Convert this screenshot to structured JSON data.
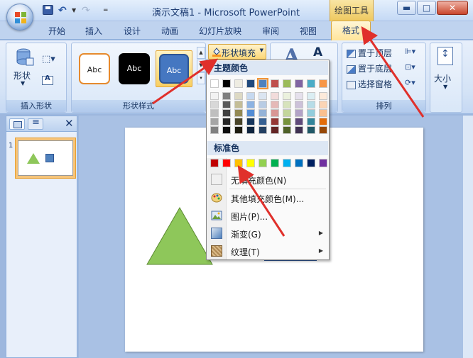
{
  "window": {
    "title": "演示文稿1 - Microsoft PowerPoint",
    "contextual_label": "绘图工具"
  },
  "title_buttons": {
    "min": "▬",
    "max": "□",
    "close": "✕"
  },
  "quick_access": {
    "undo": "↶",
    "redo": "↷",
    "dropdown": "▼",
    "customize": "═"
  },
  "tabs": [
    "开始",
    "插入",
    "设计",
    "动画",
    "幻灯片放映",
    "审阅",
    "视图",
    "格式"
  ],
  "ribbon": {
    "insert_shapes": {
      "shape_button": "形状",
      "group_label": "插入形状"
    },
    "shape_styles": {
      "styles": [
        "Abc",
        "Abc",
        "Abc"
      ],
      "group_label": "形状样式",
      "fill_button": "形状填充"
    },
    "arrange": {
      "bring_front": "置于顶层",
      "send_back": "置于底层",
      "selection_pane": "选择窗格",
      "group_label": "排列"
    },
    "size": {
      "label": "大小"
    }
  },
  "fill_menu": {
    "theme_colors_label": "主题颜色",
    "standard_colors_label": "标准色",
    "theme_top": [
      "#ffffff",
      "#000000",
      "#eeece1",
      "#1f497d",
      "#4f81bd",
      "#c0504d",
      "#9bbb59",
      "#8064a2",
      "#4bacc6",
      "#f79646"
    ],
    "theme_shades": [
      [
        "#f2f2f2",
        "#d8d8d8",
        "#bfbfbf",
        "#a5a5a5",
        "#7f7f7f"
      ],
      [
        "#7f7f7f",
        "#595959",
        "#3f3f3f",
        "#262626",
        "#0c0c0c"
      ],
      [
        "#ddd9c3",
        "#c4bd97",
        "#938953",
        "#494429",
        "#1d1b10"
      ],
      [
        "#c6d9f0",
        "#8db3e2",
        "#548dd4",
        "#17365d",
        "#0f243e"
      ],
      [
        "#dbe5f1",
        "#b8cce4",
        "#95b3d7",
        "#366092",
        "#244061"
      ],
      [
        "#f2dcdb",
        "#e5b9b7",
        "#d99694",
        "#953734",
        "#632423"
      ],
      [
        "#ebf1dd",
        "#d7e3bc",
        "#c3d69b",
        "#76923c",
        "#4f6128"
      ],
      [
        "#e5e0ec",
        "#ccc1d9",
        "#b2a2c7",
        "#5f497a",
        "#3f3151"
      ],
      [
        "#dbeef3",
        "#b7dde8",
        "#92cddc",
        "#31859b",
        "#205867"
      ],
      [
        "#fdeada",
        "#fbd5b5",
        "#fac08f",
        "#e36c09",
        "#974806"
      ]
    ],
    "standard": [
      "#c00000",
      "#ff0000",
      "#ffc000",
      "#ffff00",
      "#92d050",
      "#00b050",
      "#00b0f0",
      "#0070c0",
      "#002060",
      "#7030a0"
    ],
    "selected_theme_index": 4,
    "items": [
      {
        "label": "无填充颜色(N)",
        "icon": "no-fill-icon"
      },
      {
        "label": "其他填充颜色(M)...",
        "icon": "palette-icon"
      },
      {
        "label": "图片(P)...",
        "icon": "picture-icon"
      },
      {
        "label": "渐变(G)",
        "icon": "gradient-icon",
        "submenu": true
      },
      {
        "label": "纹理(T)",
        "icon": "texture-icon",
        "submenu": true
      }
    ],
    "submenu_arrow": "▶"
  },
  "slides_pane": {
    "slide_number": "1",
    "close": "✕"
  },
  "colors": {
    "accent_format_tab": "#ffe49a",
    "arrow": "#e0302b",
    "triangle_fill": "#8ec75a",
    "rect_fill": "#4f81bd"
  }
}
